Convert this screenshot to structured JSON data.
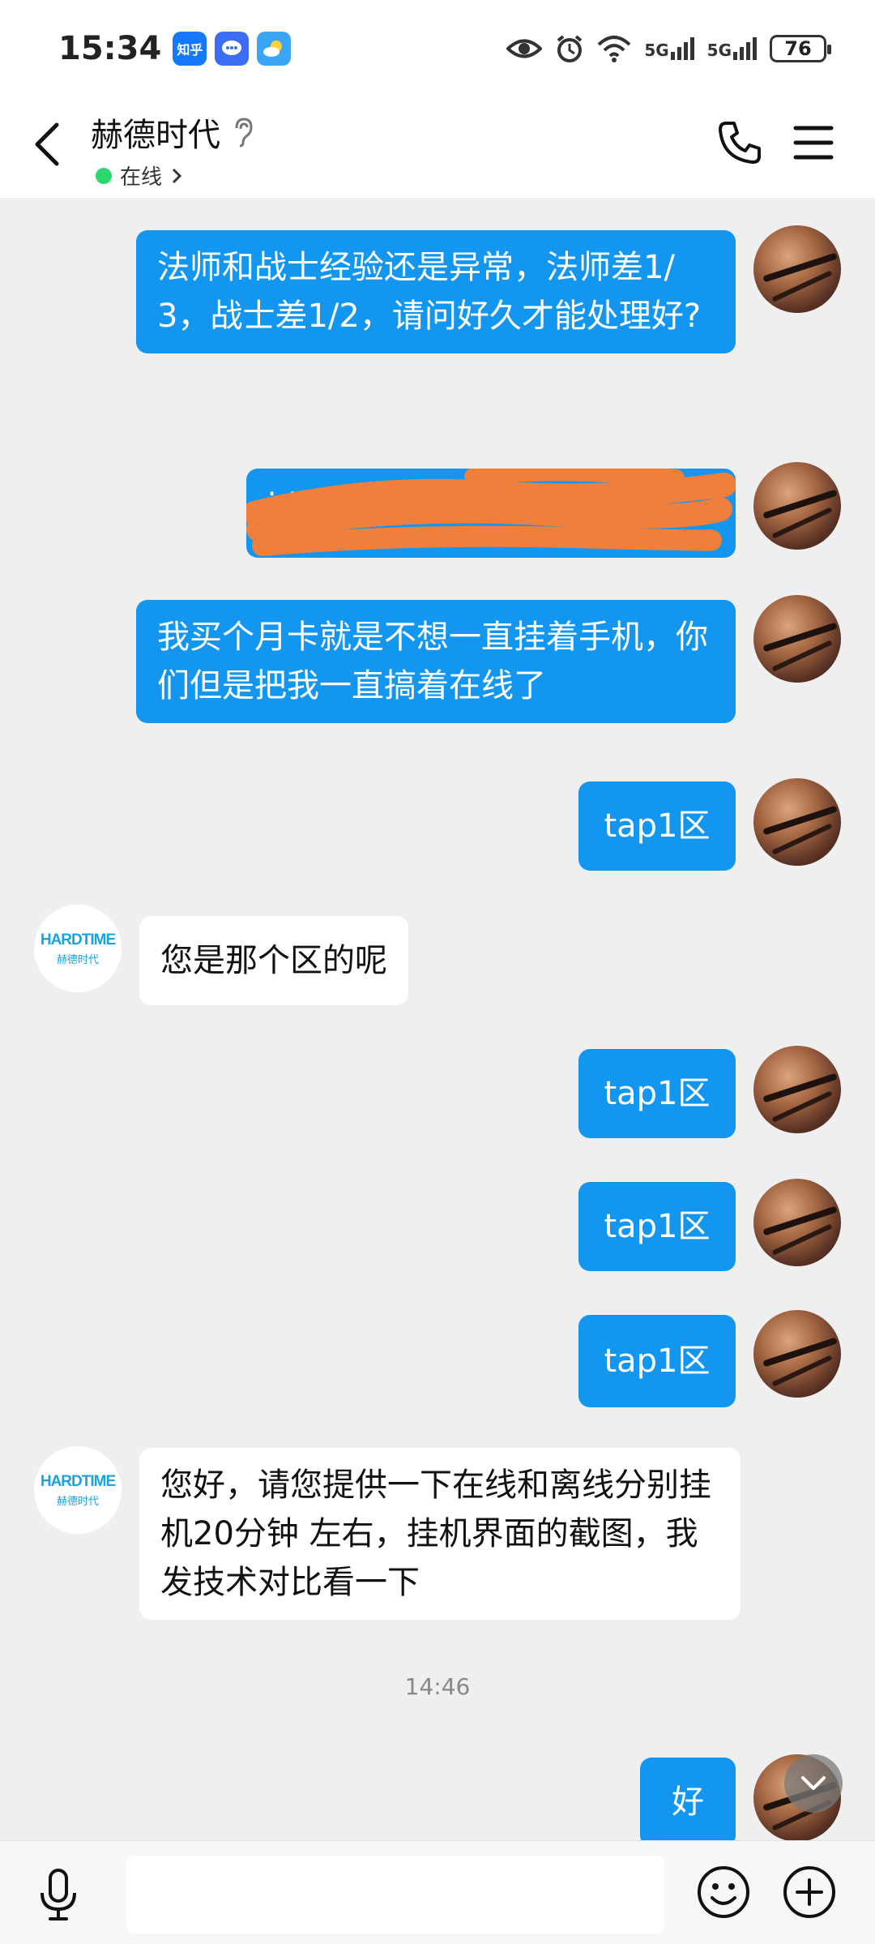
{
  "status": {
    "time": "15:34",
    "apps": [
      "知乎",
      "消息",
      "天气"
    ],
    "signal1": "5G",
    "signal2": "5G",
    "battery": "76"
  },
  "header": {
    "title": "赫德时代",
    "status": "在线"
  },
  "messages": [
    {
      "from": "me",
      "text": "法师和战士经验还是异常，法师差1/3，战士差1/2，请问好久才能处理好?"
    },
    {
      "from": "me",
      "text": "id号 ... 78",
      "redacted": true
    },
    {
      "from": "me",
      "text": "我买个月卡就是不想一直挂着手机，你们但是把我一直搞着在线了"
    },
    {
      "from": "me",
      "text": "tap1区"
    },
    {
      "from": "them",
      "text": "您是那个区的呢"
    },
    {
      "from": "me",
      "text": "tap1区"
    },
    {
      "from": "me",
      "text": "tap1区"
    },
    {
      "from": "me",
      "text": "tap1区"
    },
    {
      "from": "them",
      "text": "您好，请您提供一下在线和离线分别挂机20分钟  左右，挂机界面的截图，我发技术对比看一下"
    },
    {
      "from": "me",
      "text": "好"
    }
  ],
  "timestamp": "14:46",
  "logo": {
    "main": "HARDTIME",
    "sub": "赫德时代"
  },
  "input": {
    "placeholder": ""
  }
}
